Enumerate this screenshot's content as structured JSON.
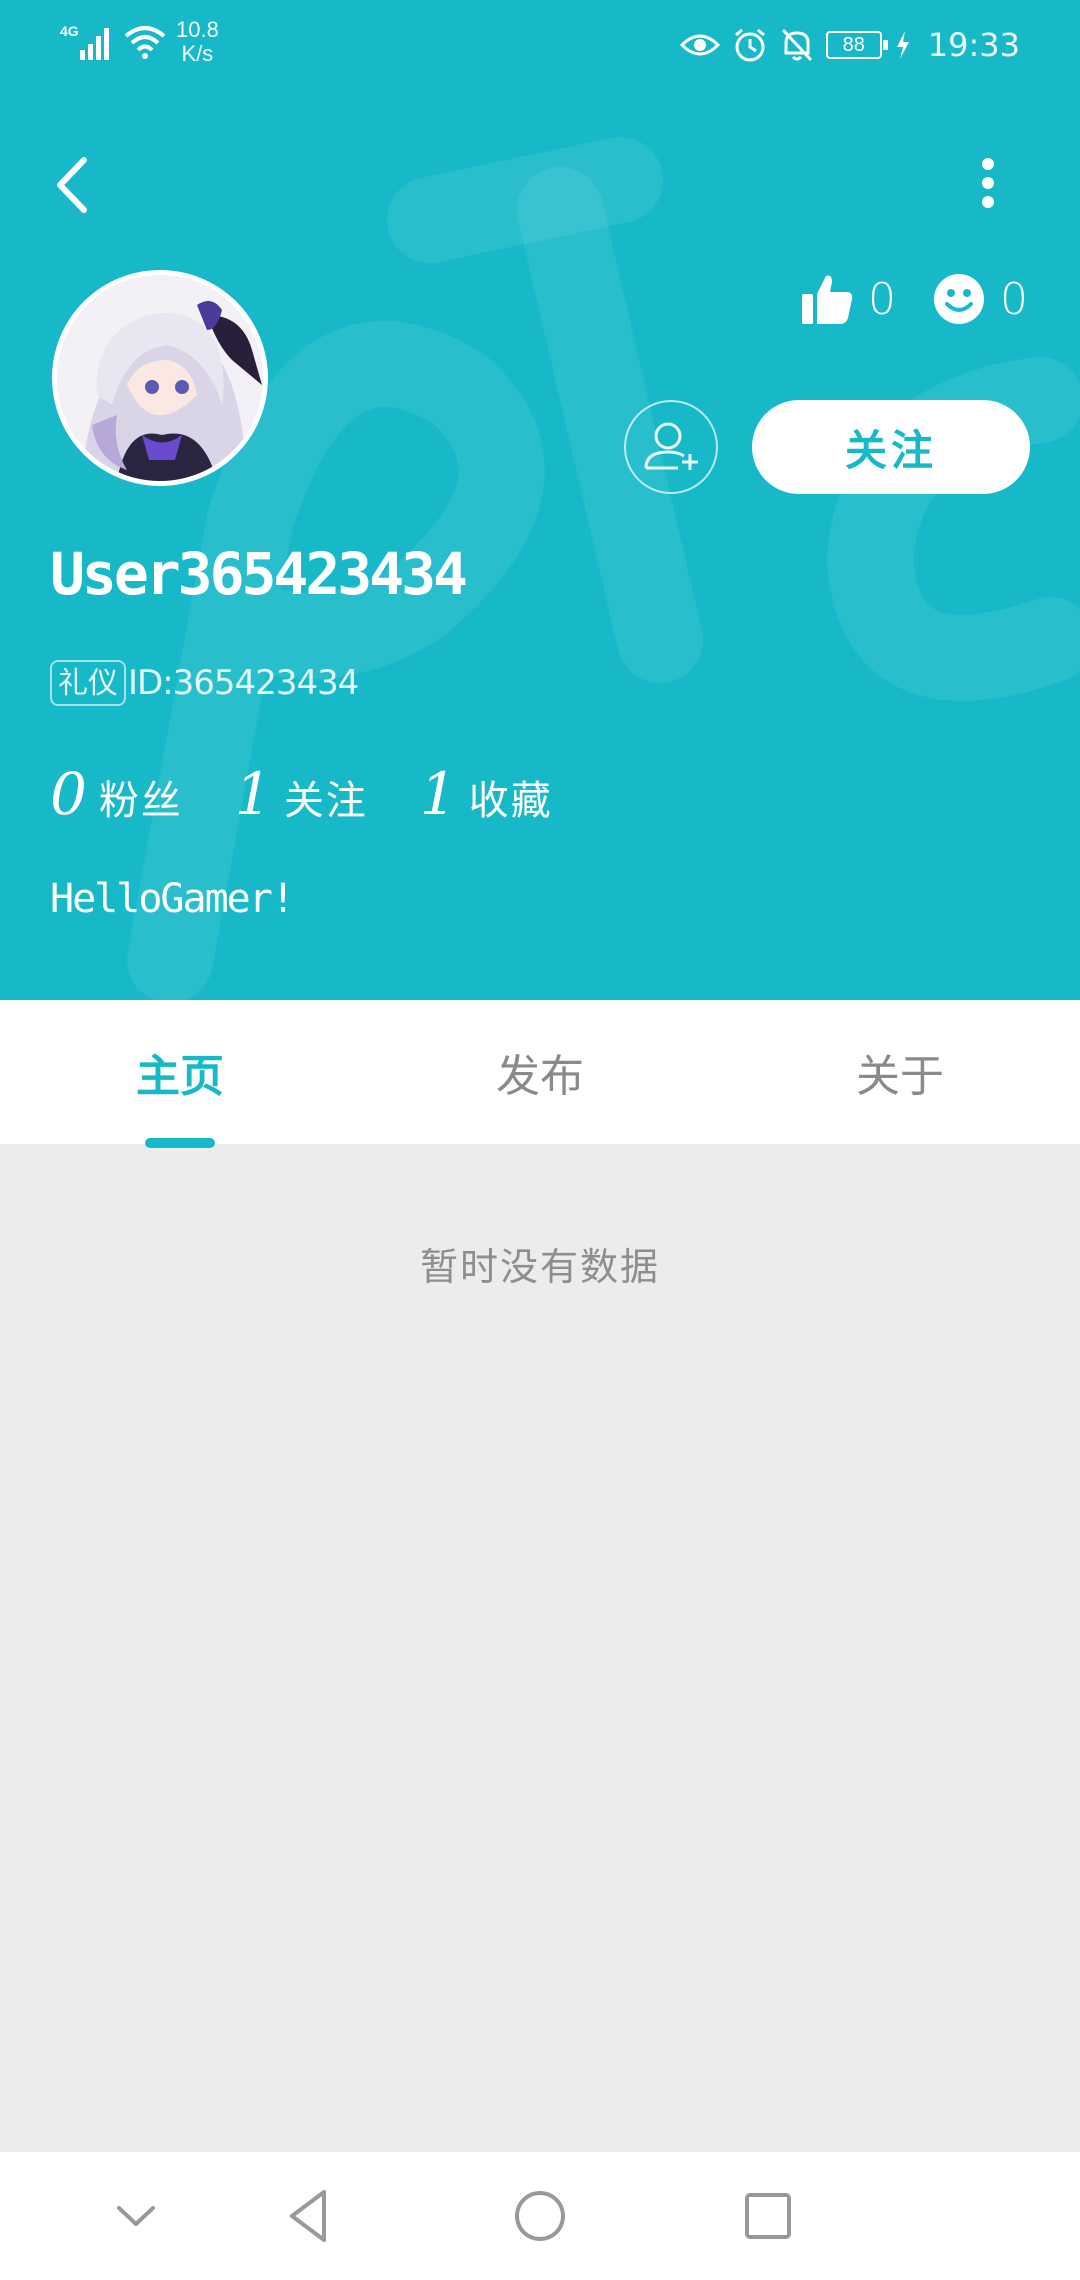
{
  "status_bar": {
    "network_label": "4G",
    "net_speed_value": "10.8",
    "net_speed_unit": "K/s",
    "battery": "88",
    "time": "19:33",
    "icons": [
      "signal-icon",
      "wifi-icon",
      "eye-comfort-icon",
      "alarm-icon",
      "mute-icon",
      "battery-icon",
      "charging-icon"
    ]
  },
  "header": {
    "background_color": "#17b9c8",
    "back_icon": "chevron-left-icon",
    "more_icon": "more-vertical-icon"
  },
  "profile": {
    "username": "User365423434",
    "badge": "礼仪",
    "id_text": "ID:365423434",
    "likes_count": "0",
    "smiles_count": "0",
    "follow_label": "关注",
    "bio": "HelloGamer!"
  },
  "stats": [
    {
      "value": "0",
      "label": "粉丝"
    },
    {
      "value": "1",
      "label": "关注"
    },
    {
      "value": "1",
      "label": "收藏"
    }
  ],
  "tabs": [
    {
      "label": "主页",
      "active": true
    },
    {
      "label": "发布",
      "active": false
    },
    {
      "label": "关于",
      "active": false
    }
  ],
  "content": {
    "empty_message": "暂时没有数据"
  },
  "nav_bar": {
    "icons": [
      "hide-nav-icon",
      "back-triangle-icon",
      "home-circle-icon",
      "recents-square-icon"
    ]
  }
}
